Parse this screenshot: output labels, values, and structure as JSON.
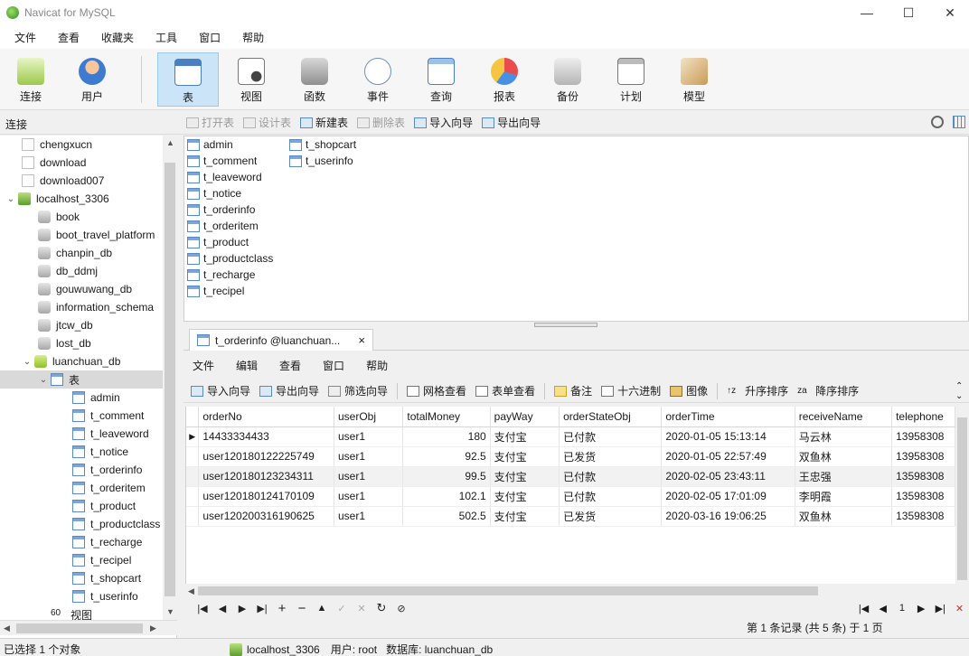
{
  "window": {
    "title": "Navicat for MySQL"
  },
  "menubar": [
    "文件",
    "查看",
    "收藏夹",
    "工具",
    "窗口",
    "帮助"
  ],
  "toolbar": [
    {
      "label": "连接",
      "icon": "connect-icon"
    },
    {
      "label": "用户",
      "icon": "user-icon"
    },
    {
      "label": "表",
      "icon": "table-icon",
      "active": true
    },
    {
      "label": "视图",
      "icon": "view-icon"
    },
    {
      "label": "函数",
      "icon": "function-icon"
    },
    {
      "label": "事件",
      "icon": "event-icon"
    },
    {
      "label": "查询",
      "icon": "query-icon"
    },
    {
      "label": "报表",
      "icon": "report-icon"
    },
    {
      "label": "备份",
      "icon": "backup-icon"
    },
    {
      "label": "计划",
      "icon": "schedule-icon"
    },
    {
      "label": "模型",
      "icon": "model-icon"
    }
  ],
  "connection_header": "连接",
  "subtoolbar": [
    {
      "label": "打开表",
      "disabled": true
    },
    {
      "label": "设计表",
      "disabled": true
    },
    {
      "label": "新建表",
      "disabled": false
    },
    {
      "label": "删除表",
      "disabled": true
    },
    {
      "label": "导入向导",
      "disabled": false
    },
    {
      "label": "导出向导",
      "disabled": false
    }
  ],
  "tree": {
    "top_items": [
      "chengxucn",
      "download",
      "download007"
    ],
    "connection": "localhost_3306",
    "databases": [
      "book",
      "boot_travel_platform",
      "chanpin_db",
      "db_ddmj",
      "gouwuwang_db",
      "information_schema",
      "jtcw_db",
      "lost_db"
    ],
    "open_database": "luanchuan_db",
    "tables_folder": "表",
    "tables": [
      "admin",
      "t_comment",
      "t_leaveword",
      "t_notice",
      "t_orderinfo",
      "t_orderitem",
      "t_product",
      "t_productclass",
      "t_recharge",
      "t_recipel",
      "t_shopcart",
      "t_userinfo"
    ],
    "views_folder": "视图"
  },
  "object_list": [
    "admin",
    "t_comment",
    "t_leaveword",
    "t_notice",
    "t_orderinfo",
    "t_orderitem",
    "t_product",
    "t_productclass",
    "t_recharge",
    "t_recipel",
    "t_shopcart",
    "t_userinfo"
  ],
  "tab": {
    "label": "t_orderinfo @luanchuan...",
    "close": "×"
  },
  "inner_menu": [
    "文件",
    "编辑",
    "查看",
    "窗口",
    "帮助"
  ],
  "inner_toolbar": [
    "导入向导",
    "导出向导",
    "筛选向导",
    "网格查看",
    "表单查看",
    "备注",
    "十六进制",
    "图像",
    "升序排序",
    "降序排序"
  ],
  "grid": {
    "columns": [
      "orderNo",
      "userObj",
      "totalMoney",
      "payWay",
      "orderStateObj",
      "orderTime",
      "receiveName",
      "telephone"
    ],
    "rows": [
      [
        "14433334433",
        "user1",
        "180",
        "支付宝",
        "已付款",
        "2020-01-05 15:13:14",
        "马云林",
        "13958308"
      ],
      [
        "user120180122225749",
        "user1",
        "92.5",
        "支付宝",
        "已发货",
        "2020-01-05 22:57:49",
        "双鱼林",
        "13958308"
      ],
      [
        "user120180123234311",
        "user1",
        "99.5",
        "支付宝",
        "已付款",
        "2020-02-05 23:43:11",
        "王忠强",
        "13598308"
      ],
      [
        "user120180124170109",
        "user1",
        "102.1",
        "支付宝",
        "已付款",
        "2020-02-05 17:01:09",
        "李明霞",
        "13598308"
      ],
      [
        "user120200316190625",
        "user1",
        "502.5",
        "支付宝",
        "已发货",
        "2020-03-16 19:06:25",
        "双鱼林",
        "13598308"
      ]
    ]
  },
  "record_info": "第 1 条记录 (共 5 条) 于 1 页",
  "page_number": "1",
  "status": {
    "selection": "已选择 1 个对象",
    "connection": "localhost_3306",
    "user": "用户: root",
    "database": "数据库: luanchuan_db"
  }
}
